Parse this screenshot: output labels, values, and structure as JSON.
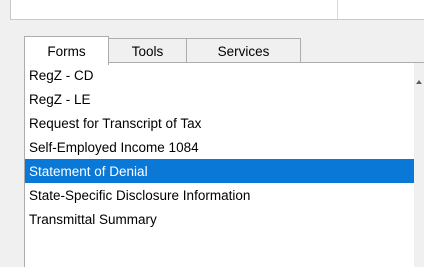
{
  "tabs": [
    {
      "label": "Forms"
    },
    {
      "label": "Tools"
    },
    {
      "label": "Services"
    }
  ],
  "forms_list": {
    "items": [
      {
        "label": "RegZ - CD"
      },
      {
        "label": "RegZ - LE"
      },
      {
        "label": "Request for Transcript of Tax"
      },
      {
        "label": "Self-Employed Income 1084"
      },
      {
        "label": "Statement of Denial"
      },
      {
        "label": "State-Specific Disclosure Information"
      },
      {
        "label": "Transmittal Summary"
      }
    ],
    "selected_label": "Statement of Denial"
  },
  "colors": {
    "selection_bg": "#0a78d7",
    "selection_text": "#ffffff"
  },
  "icons": {
    "scroll_up": "scroll-up-arrow-icon"
  }
}
